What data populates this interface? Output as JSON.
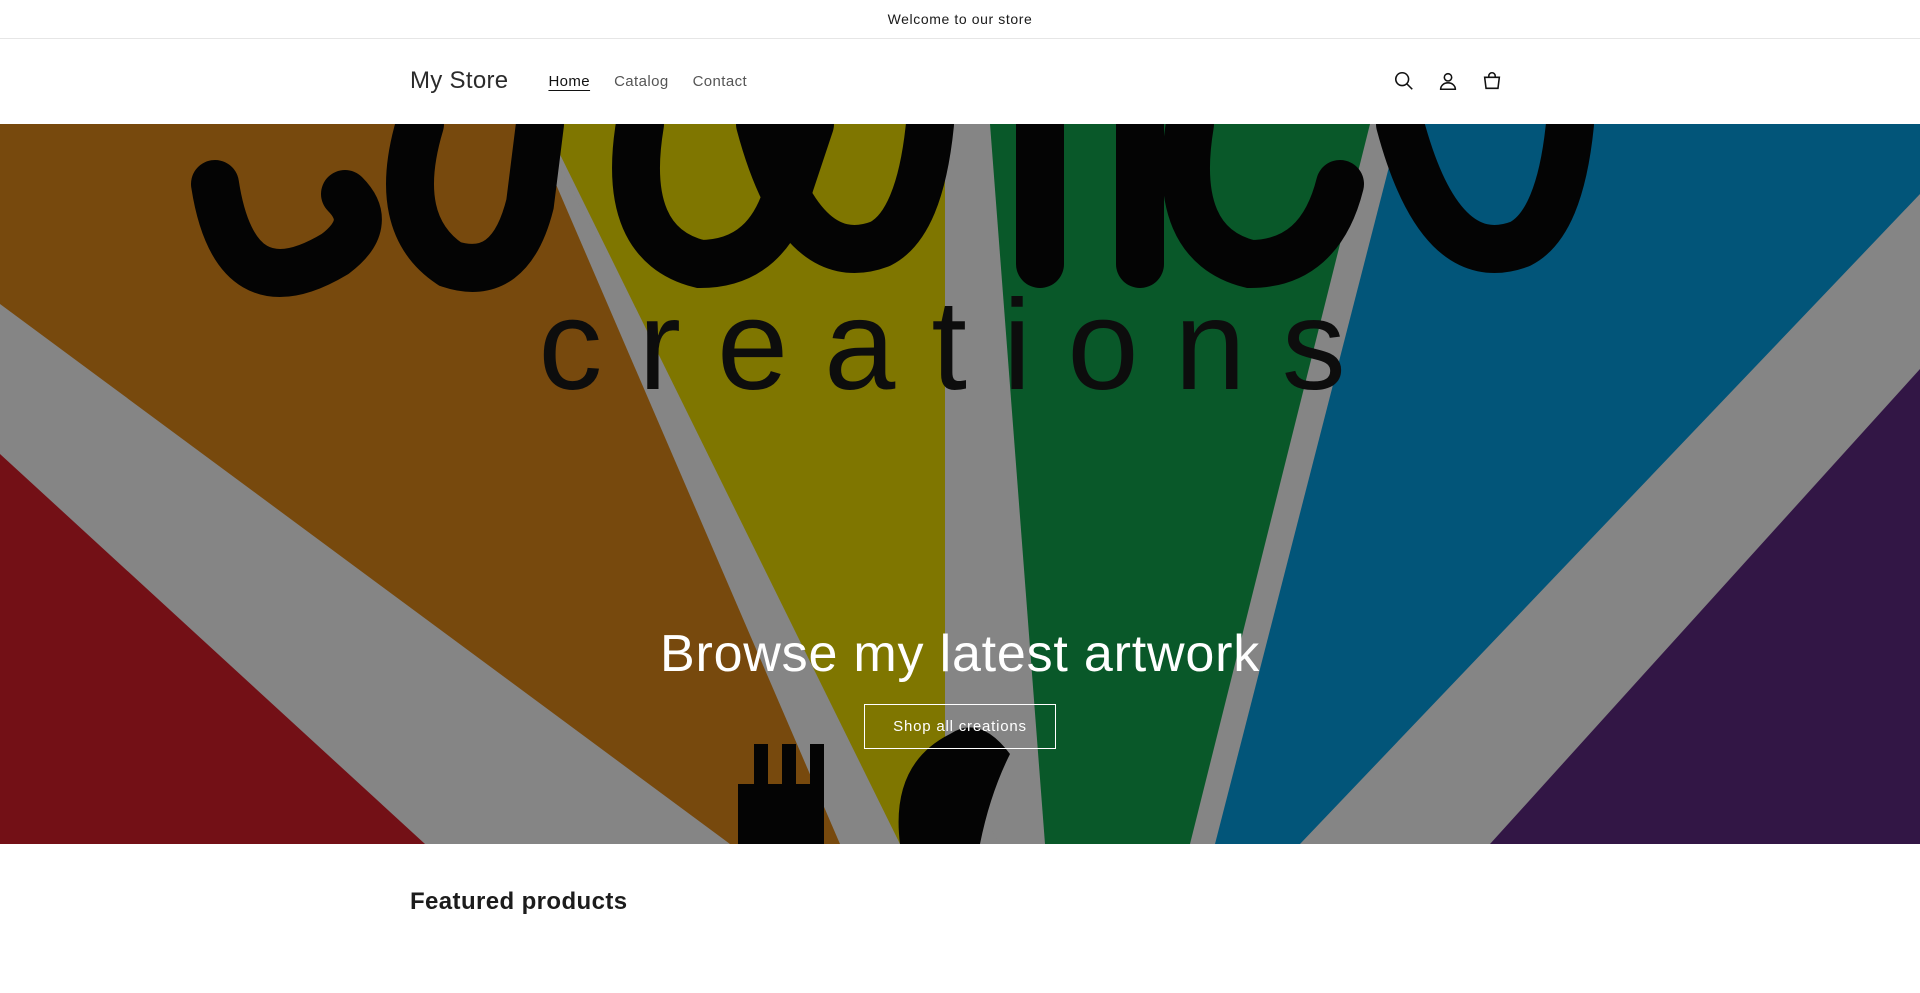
{
  "announcement": {
    "text": "Welcome to our store"
  },
  "header": {
    "logo": "My Store",
    "nav": [
      {
        "label": "Home",
        "active": true
      },
      {
        "label": "Catalog",
        "active": false
      },
      {
        "label": "Contact",
        "active": false
      }
    ],
    "icons": [
      "search-icon",
      "account-icon",
      "cart-icon"
    ]
  },
  "hero": {
    "image_text": "creations",
    "title": "Browse my latest artwork",
    "button_label": "Shop all creations"
  },
  "featured": {
    "heading": "Featured products"
  },
  "colors": {
    "red": "#8d141c",
    "orange": "#925a10",
    "yellow": "#9b9100",
    "green": "#0b6c33",
    "blue": "#036894",
    "purple": "#3e1b55",
    "stripe": "#a3a3a3"
  }
}
